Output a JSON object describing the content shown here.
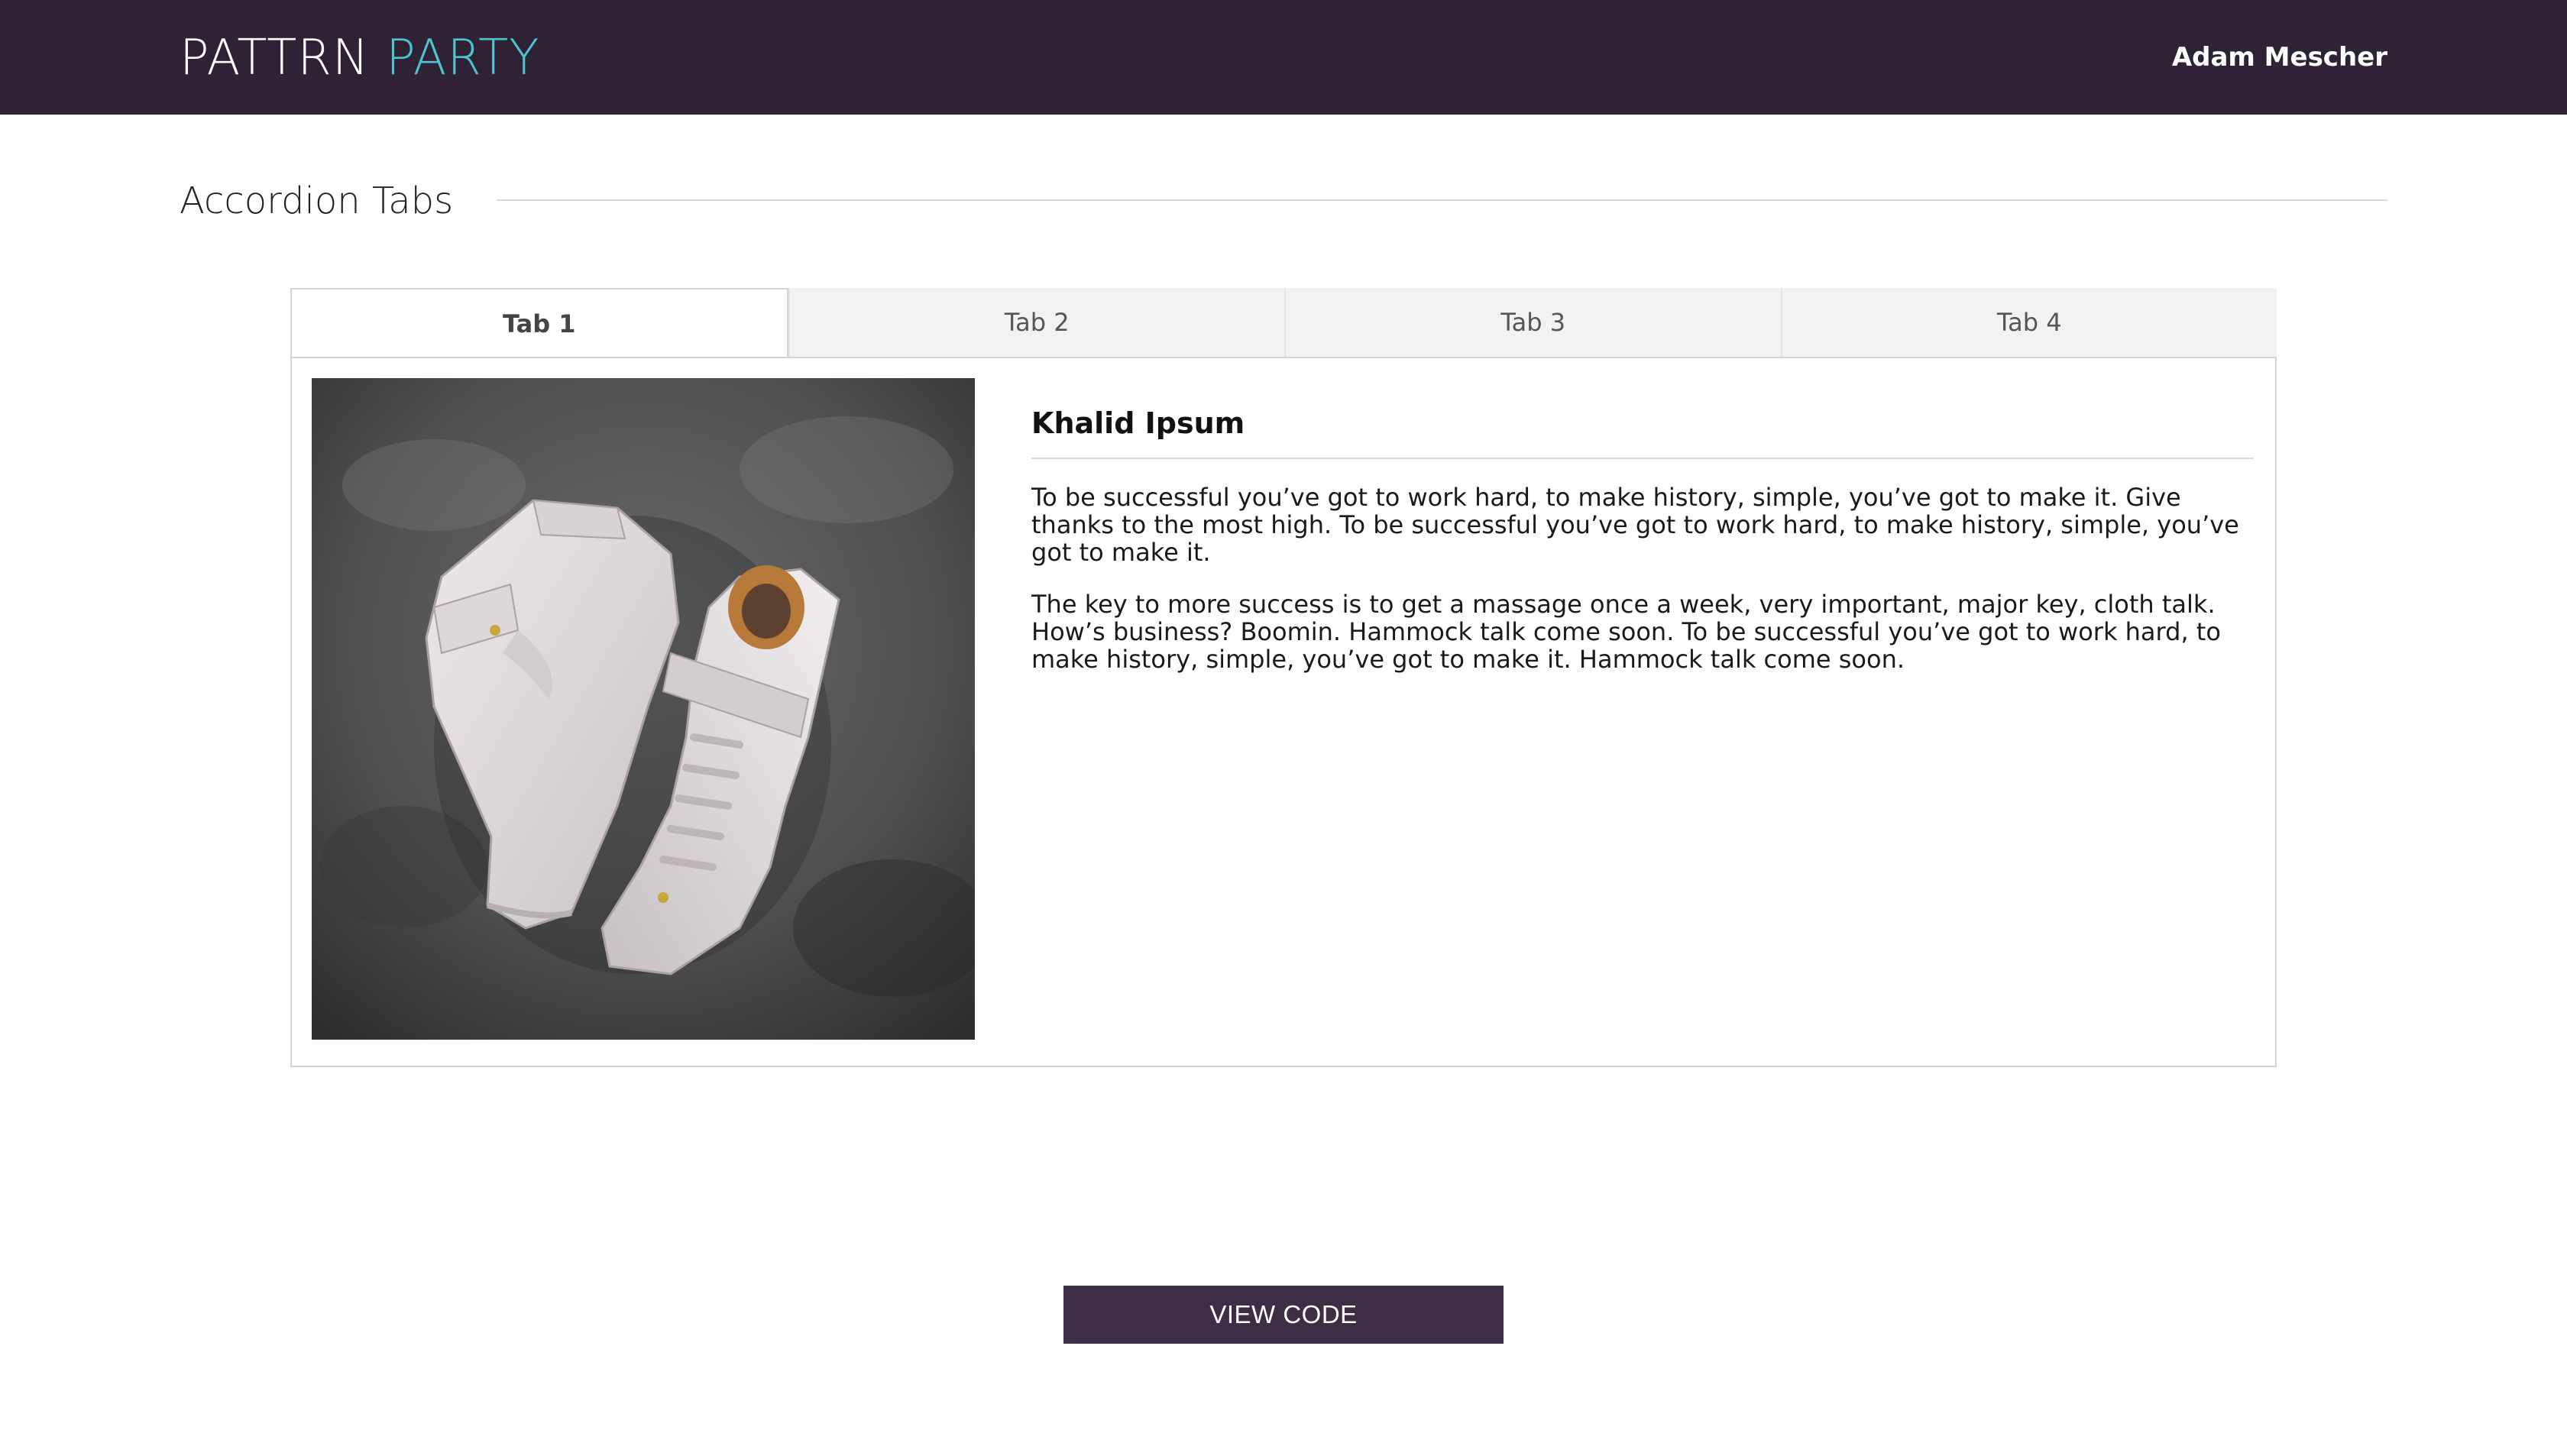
{
  "header": {
    "brand_part1": "PATTRN",
    "brand_part2": "PARTY",
    "user_name": "Adam Mescher"
  },
  "section": {
    "title": "Accordion Tabs"
  },
  "tabs": [
    {
      "label": "Tab 1",
      "active": true
    },
    {
      "label": "Tab 2",
      "active": false
    },
    {
      "label": "Tab 3",
      "active": false
    },
    {
      "label": "Tab 4",
      "active": false
    }
  ],
  "panel": {
    "heading": "Khalid Ipsum",
    "paragraphs": [
      "To be successful you’ve got to work hard, to make history, simple, you’ve got to make it. Give thanks to the most high. To be successful you’ve got to work hard, to make history, simple, you’ve got to make it.",
      "The key to more success is to get a massage once a week, very important, major key, cloth talk. How’s business? Boomin. Hammock talk come soon. To be successful you’ve got to work hard, to make history, simple, you’ve got to make it. Hammock talk come soon."
    ]
  },
  "footer": {
    "view_code_label": "VIEW CODE"
  },
  "colors": {
    "header_bg": "#302236",
    "brand_accent": "#4cc6cc",
    "button_bg": "#3d2e46"
  }
}
